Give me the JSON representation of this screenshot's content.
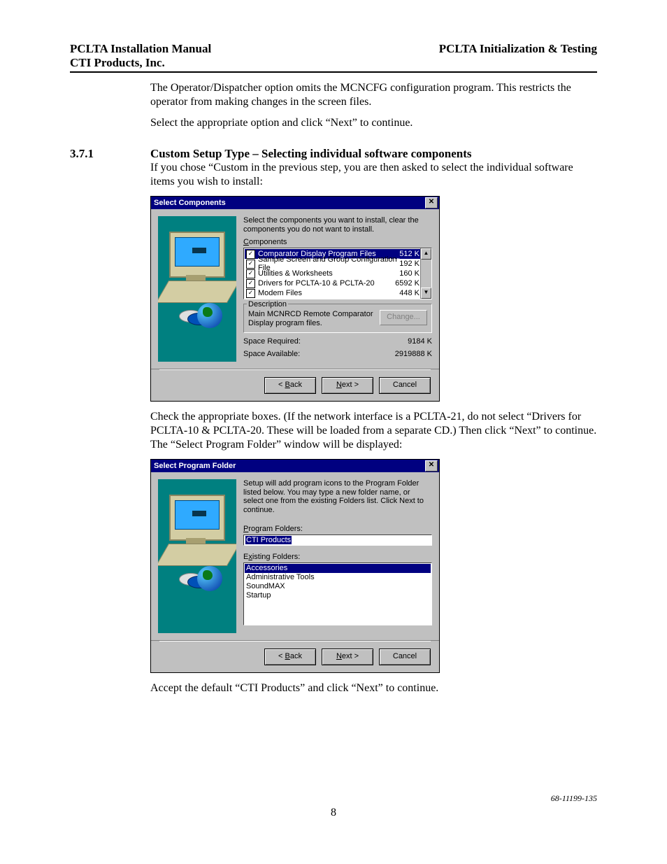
{
  "header": {
    "left_line1": "PCLTA Installation Manual",
    "left_line2": "CTI Products, Inc.",
    "right": "PCLTA Initialization & Testing"
  },
  "intro_p1": "The Operator/Dispatcher option omits the MCNCFG configuration program.  This restricts the operator from making changes in the screen files.",
  "intro_p2": "Select the appropriate option and click “Next” to continue.",
  "section": {
    "num": "3.7.1",
    "title": "Custom Setup Type – Selecting individual software components"
  },
  "section_p1": "If you chose “Custom in the previous step, you are then asked to select the individual software items you wish to install:",
  "dlg1": {
    "title": "Select Components",
    "instr": "Select the components you want to install, clear the components you do not want to install.",
    "comp_label_pre": "C",
    "comp_label_rest": "omponents",
    "rows": [
      {
        "name": "Comparator Display Program Files",
        "size": "512 K",
        "sel": true
      },
      {
        "name": "Sample Screen and Group Configuration File",
        "size": "192 K",
        "sel": false
      },
      {
        "name": "Utilities & Worksheets",
        "size": "160 K",
        "sel": false
      },
      {
        "name": "Drivers for PCLTA-10 & PCLTA-20",
        "size": "6592 K",
        "sel": false
      },
      {
        "name": "Modem Files",
        "size": "448 K",
        "sel": false
      }
    ],
    "desc_label": "Description",
    "desc_text": "Main MCNRCD Remote Comparator Display program files.",
    "change_btn": "Change...",
    "space_req_label": "Space Required:",
    "space_req_val": "9184 K",
    "space_avail_label": "Space Available:",
    "space_avail_val": "2919888 K",
    "back_pre": "< ",
    "back_u": "B",
    "back_rest": "ack",
    "next_u": "N",
    "next_rest": "ext >",
    "cancel": "Cancel"
  },
  "mid_p1": "Check the appropriate boxes.  (If the network interface is a PCLTA-21, do not select “Drivers for PCLTA-10 & PCLTA-20.  These will be loaded from a separate CD.)  Then click “Next” to continue.  The “Select Program Folder” window will be displayed:",
  "dlg2": {
    "title": "Select Program Folder",
    "instr": "Setup will add program icons to the Program Folder listed below. You may type a new folder name, or select one from the existing Folders list.  Click Next to continue.",
    "pf_label_u": "P",
    "pf_label_rest": "rogram Folders:",
    "pf_value": "CTI Products",
    "ef_label_pre": "E",
    "ef_label_u": "x",
    "ef_label_rest": "isting Folders:",
    "items": [
      {
        "name": "Accessories",
        "sel": true
      },
      {
        "name": "Administrative Tools",
        "sel": false
      },
      {
        "name": "SoundMAX",
        "sel": false
      },
      {
        "name": "Startup",
        "sel": false
      }
    ],
    "back_pre": "< ",
    "back_u": "B",
    "back_rest": "ack",
    "next_u": "N",
    "next_rest": "ext >",
    "cancel": "Cancel"
  },
  "final_p": "Accept the default “CTI Products” and click “Next” to continue.",
  "footer": {
    "docnum": "68-11199-135",
    "page": "8"
  }
}
